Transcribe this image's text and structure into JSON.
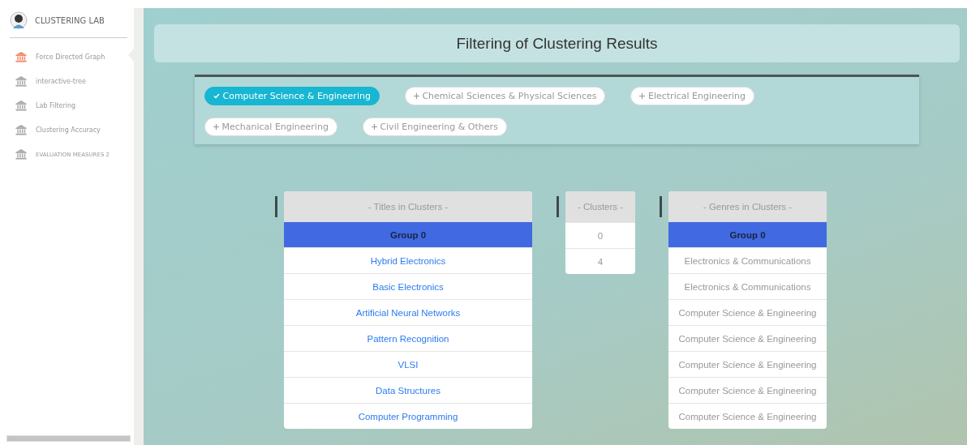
{
  "sidebar": {
    "title": "CLUSTERING LAB",
    "items": [
      {
        "label": "Force Directed Graph",
        "selected": true
      },
      {
        "label": "interactive-tree",
        "selected": false
      },
      {
        "label": "Lab Filtering",
        "selected": false
      },
      {
        "label": "Clustering Accuracy",
        "selected": false
      },
      {
        "label": "EVALUATION MEASURES 2",
        "selected": false
      }
    ]
  },
  "page_title": "Filtering of Clustering Results",
  "filters": [
    {
      "label": "Computer Science & Engineering",
      "selected": true
    },
    {
      "label": "Chemical Sciences & Physical Sciences",
      "selected": false
    },
    {
      "label": "Electrical Engineering",
      "selected": false
    },
    {
      "label": "Mechanical Engineering",
      "selected": false
    },
    {
      "label": "Civil Engineering & Others",
      "selected": false
    }
  ],
  "tables": [
    {
      "header": "- Titles in Clusters -",
      "kind": "titles",
      "rows": [
        {
          "text": "Group 0",
          "kind": "group"
        },
        {
          "text": "Hybrid Electronics",
          "kind": "item"
        },
        {
          "text": "Basic Electronics",
          "kind": "item"
        },
        {
          "text": "Artificial Neural Networks",
          "kind": "item"
        },
        {
          "text": "Pattern Recognition",
          "kind": "item"
        },
        {
          "text": "VLSI",
          "kind": "item"
        },
        {
          "text": "Data Structures",
          "kind": "item"
        },
        {
          "text": "Computer Programming",
          "kind": "item"
        }
      ]
    },
    {
      "header": "- Clusters -",
      "kind": "clusters",
      "rows": [
        {
          "text": "0",
          "kind": "value"
        },
        {
          "text": "4",
          "kind": "value"
        }
      ]
    },
    {
      "header": "- Genres in Clusters -",
      "kind": "genres",
      "rows": [
        {
          "text": "Group 0",
          "kind": "group"
        },
        {
          "text": "Electronics & Communications",
          "kind": "value"
        },
        {
          "text": "Electronics & Communications",
          "kind": "value"
        },
        {
          "text": "Computer Science & Engineering",
          "kind": "value"
        },
        {
          "text": "Computer Science & Engineering",
          "kind": "value"
        },
        {
          "text": "Computer Science & Engineering",
          "kind": "value"
        },
        {
          "text": "Computer Science & Engineering",
          "kind": "value"
        },
        {
          "text": "Computer Science & Engineering",
          "kind": "value"
        }
      ]
    }
  ]
}
